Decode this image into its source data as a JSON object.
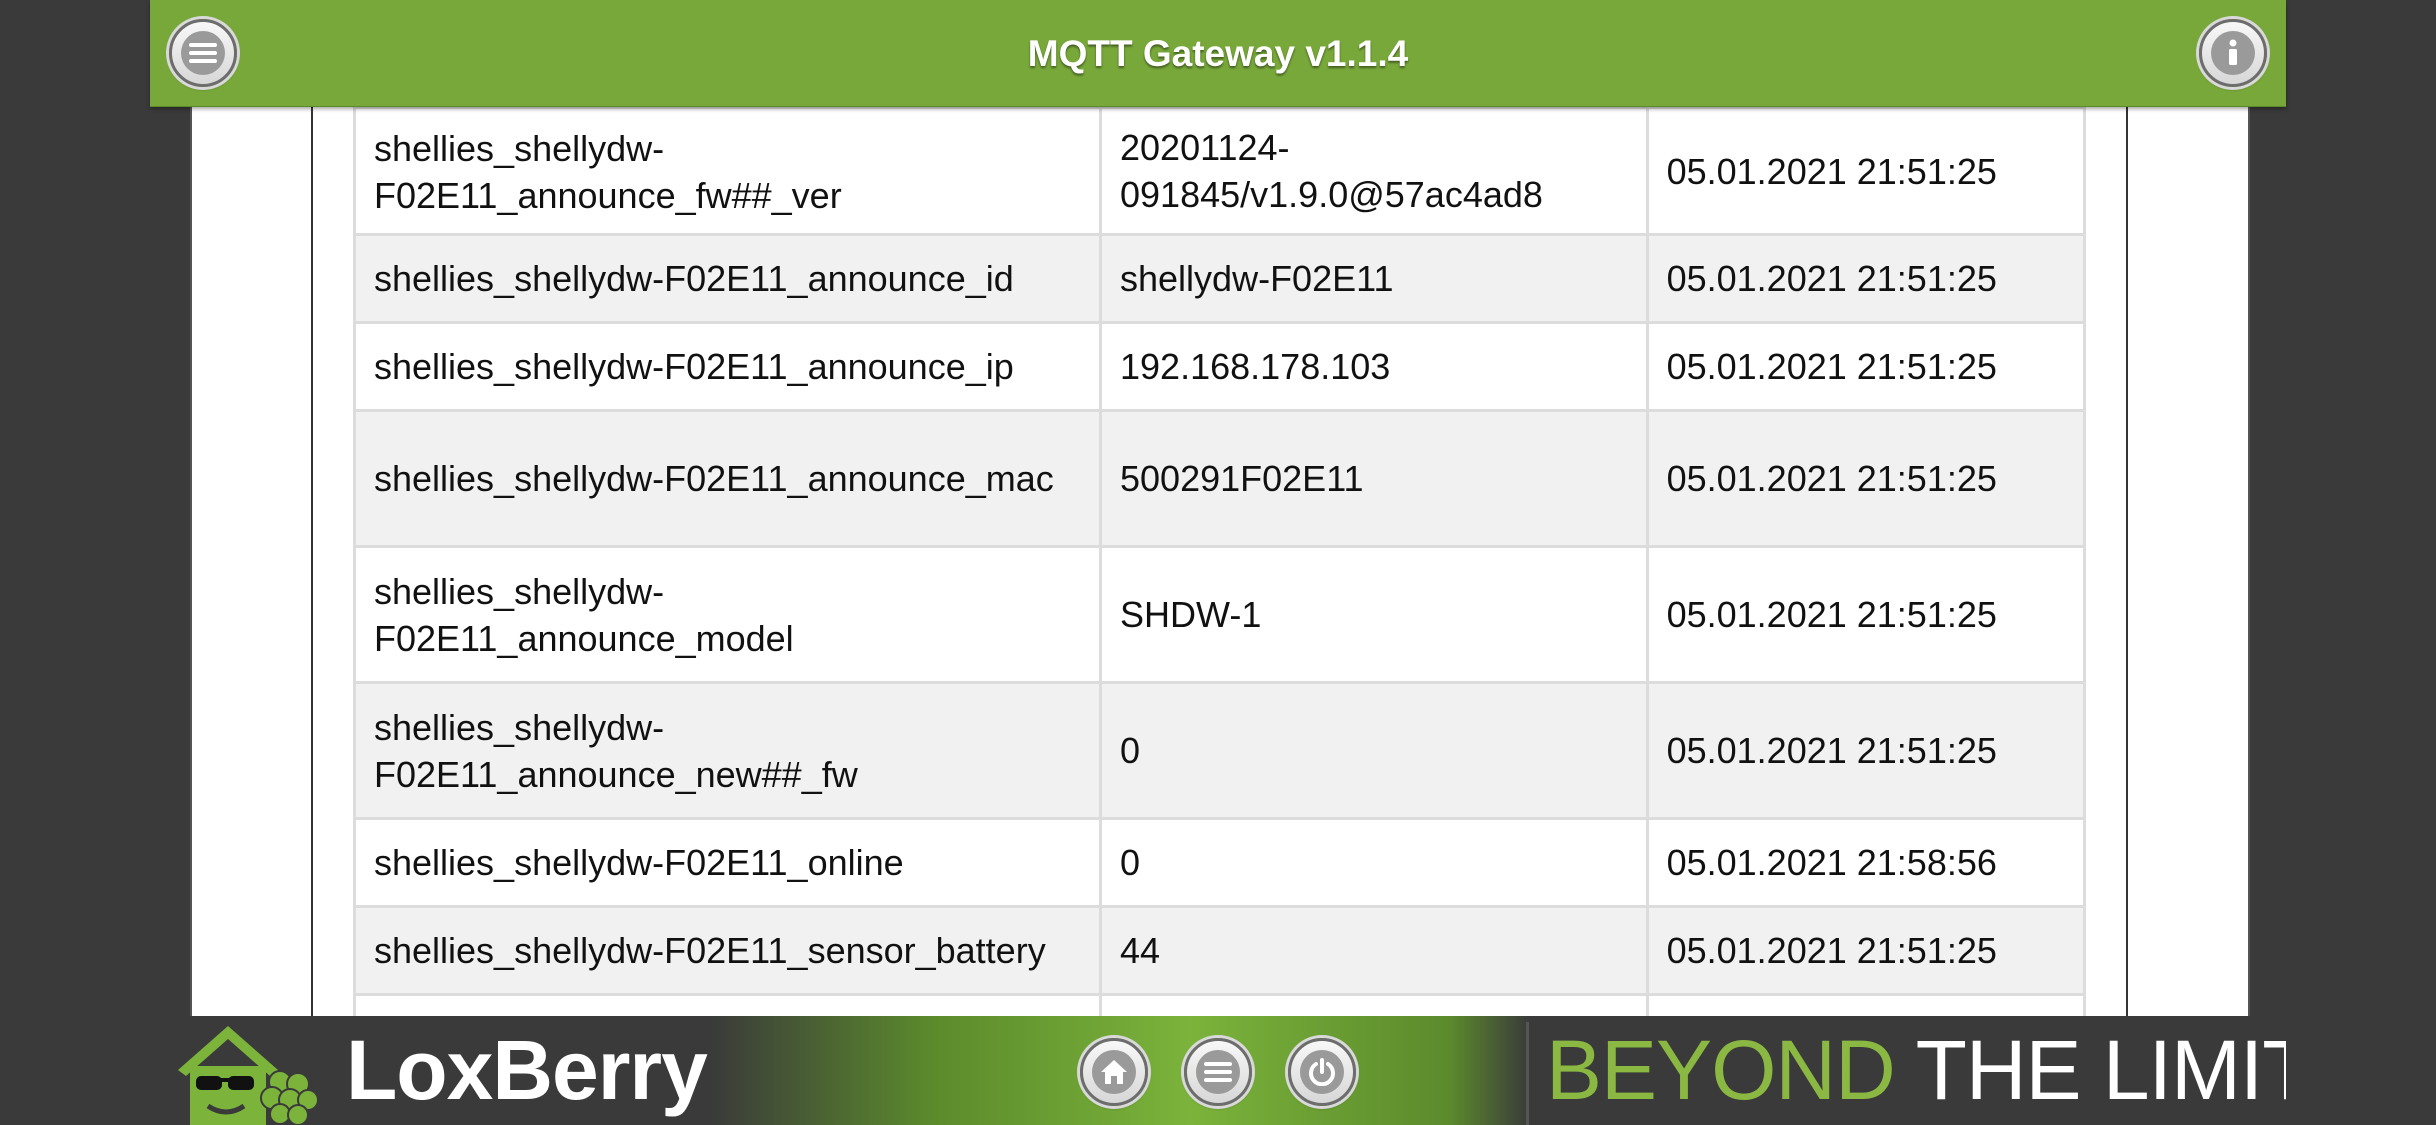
{
  "header": {
    "title": "MQTT Gateway v1.1.4",
    "menu_icon": "menu-icon",
    "info_icon": "info-icon"
  },
  "table": {
    "rows": [
      {
        "topic": "shellies_shellydw-F02E11_announce_fw##_ver",
        "value": "20201124-091845/v1.9.0@57ac4ad8",
        "timestamp": "05.01.2021 21:51:25"
      },
      {
        "topic": "shellies_shellydw-F02E11_announce_id",
        "value": "shellydw-F02E11",
        "timestamp": "05.01.2021 21:51:25"
      },
      {
        "topic": "shellies_shellydw-F02E11_announce_ip",
        "value": "192.168.178.103",
        "timestamp": "05.01.2021 21:51:25"
      },
      {
        "topic": "shellies_shellydw-F02E11_announce_mac",
        "value": "500291F02E11",
        "timestamp": "05.01.2021 21:51:25"
      },
      {
        "topic": "shellies_shellydw-F02E11_announce_model",
        "value": "SHDW-1",
        "timestamp": "05.01.2021 21:51:25"
      },
      {
        "topic": "shellies_shellydw-F02E11_announce_new##_fw",
        "value": "0",
        "timestamp": "05.01.2021 21:51:25"
      },
      {
        "topic": "shellies_shellydw-F02E11_online",
        "value": "0",
        "timestamp": "05.01.2021 21:58:56"
      },
      {
        "topic": "shellies_shellydw-F02E11_sensor_battery",
        "value": "44",
        "timestamp": "05.01.2021 21:51:25"
      }
    ]
  },
  "footer": {
    "logo_text": "LoxBerry",
    "slogan_accent": "BEYOND",
    "slogan_rest": " THE LIMITS",
    "home_icon": "home-icon",
    "menu_icon": "menu-icon",
    "power_icon": "power-icon"
  },
  "colors": {
    "brand_green": "#78a83a",
    "background_dark": "#3a3a3a",
    "row_alt": "#f1f1f1"
  }
}
